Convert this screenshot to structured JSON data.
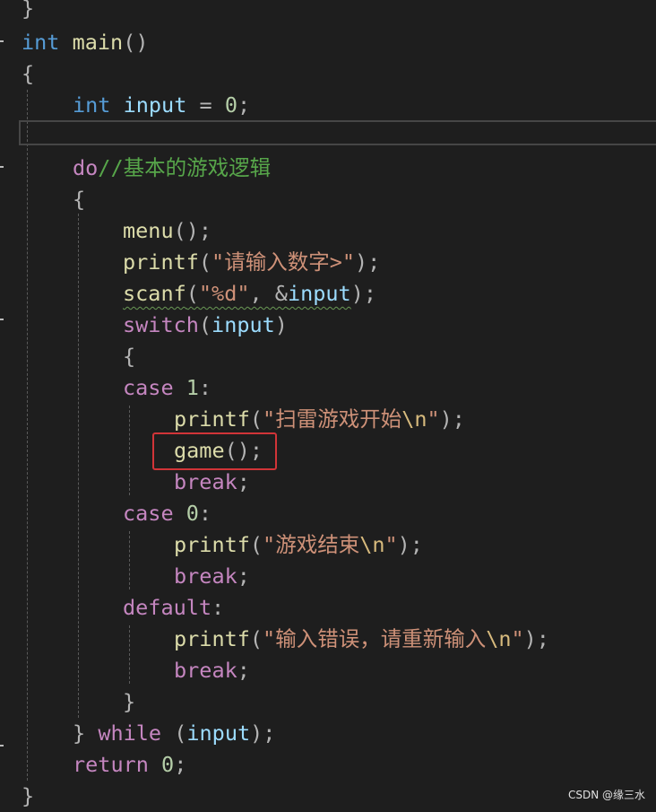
{
  "editor": {
    "lines": {
      "l00": "}",
      "l01": {
        "kw": "int",
        "name": "main",
        "paren": "()"
      },
      "l02": "{",
      "l03": {
        "kw": "int",
        "var": "input",
        "op": "=",
        "num": "0",
        "semi": ";"
      },
      "l05": {
        "kw": "do",
        "comment": "//基本的游戏逻辑"
      },
      "l06": "{",
      "l07": {
        "fn": "menu",
        "rest": "();"
      },
      "l08": {
        "fn": "printf",
        "open": "(",
        "str": "\"请输入数字>\"",
        "close": ");"
      },
      "l09": {
        "fn": "scanf",
        "open": "(",
        "str": "\"%d\"",
        "mid": ", &",
        "var": "input",
        "close": ");"
      },
      "l10": {
        "kw": "switch",
        "open": "(",
        "var": "input",
        "close": ")"
      },
      "l11": "{",
      "l12": {
        "kw": "case",
        "num": "1",
        "colon": ":"
      },
      "l13": {
        "fn": "printf",
        "open": "(",
        "str": "\"扫雷游戏开始",
        "esc": "\\n",
        "strend": "\"",
        "close": ");"
      },
      "l14": {
        "fn": "game",
        "rest": "();"
      },
      "l15": {
        "kw": "break",
        "semi": ";"
      },
      "l16": {
        "kw": "case",
        "num": "0",
        "colon": ":"
      },
      "l17": {
        "fn": "printf",
        "open": "(",
        "str": "\"游戏结束",
        "esc": "\\n",
        "strend": "\"",
        "close": ");"
      },
      "l18": {
        "kw": "break",
        "semi": ";"
      },
      "l19": {
        "kw": "default",
        "colon": ":"
      },
      "l20": {
        "fn": "printf",
        "open": "(",
        "str": "\"输入错误，请重新输入",
        "esc": "\\n",
        "strend": "\"",
        "close": ");"
      },
      "l21": {
        "kw": "break",
        "semi": ";"
      },
      "l22": "}",
      "l23": {
        "brace": "}",
        "kw": "while",
        "open": "(",
        "var": "input",
        "close": ");"
      },
      "l24": {
        "kw": "return",
        "num": "0",
        "semi": ";"
      },
      "l25": "}"
    },
    "highlighted_statement": "game();"
  },
  "colors": {
    "background": "#1e1e1e",
    "keyword_blue": "#569cd6",
    "keyword_control": "#c586c0",
    "function": "#dcdcaa",
    "variable": "#9cdcfe",
    "string": "#ce9178",
    "comment": "#57a64a",
    "highlight_box": "#d13438"
  },
  "watermark": "CSDN @缘三水"
}
